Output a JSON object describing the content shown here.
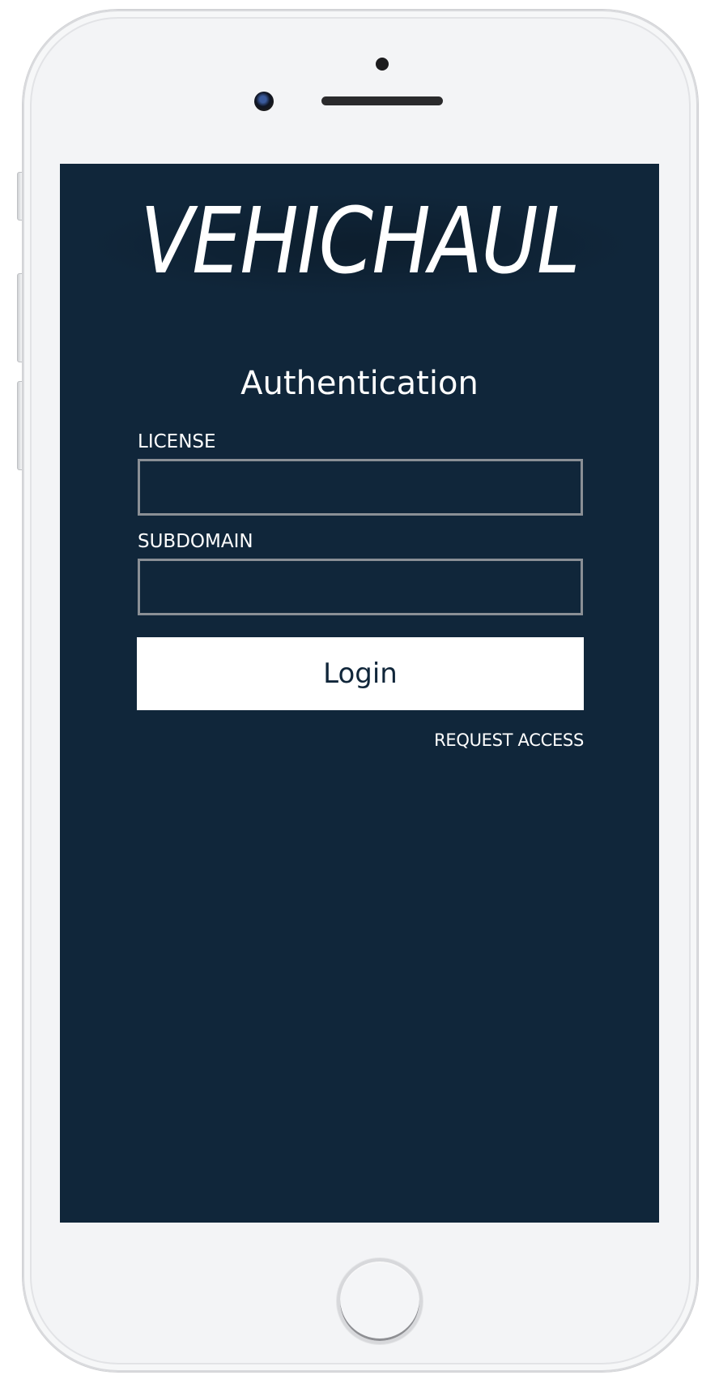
{
  "app": {
    "brand_logo_text": "VEHICHAUL"
  },
  "auth": {
    "title": "Authentication",
    "license_label": "LICENSE",
    "license_value": "",
    "subdomain_label": "SUBDOMAIN",
    "subdomain_value": "",
    "login_label": "Login",
    "request_access_label": "REQUEST ACCESS"
  },
  "theme": {
    "screen_background": "#10263a",
    "text_color": "#ffffff",
    "input_border": "#8a8f95",
    "button_background": "#ffffff",
    "button_text": "#10263a"
  },
  "device": {
    "frame_color": "#f3f4f6",
    "icons": [
      "front-camera-icon",
      "earpiece-speaker-icon",
      "proximity-sensor-icon",
      "home-button-icon"
    ]
  }
}
